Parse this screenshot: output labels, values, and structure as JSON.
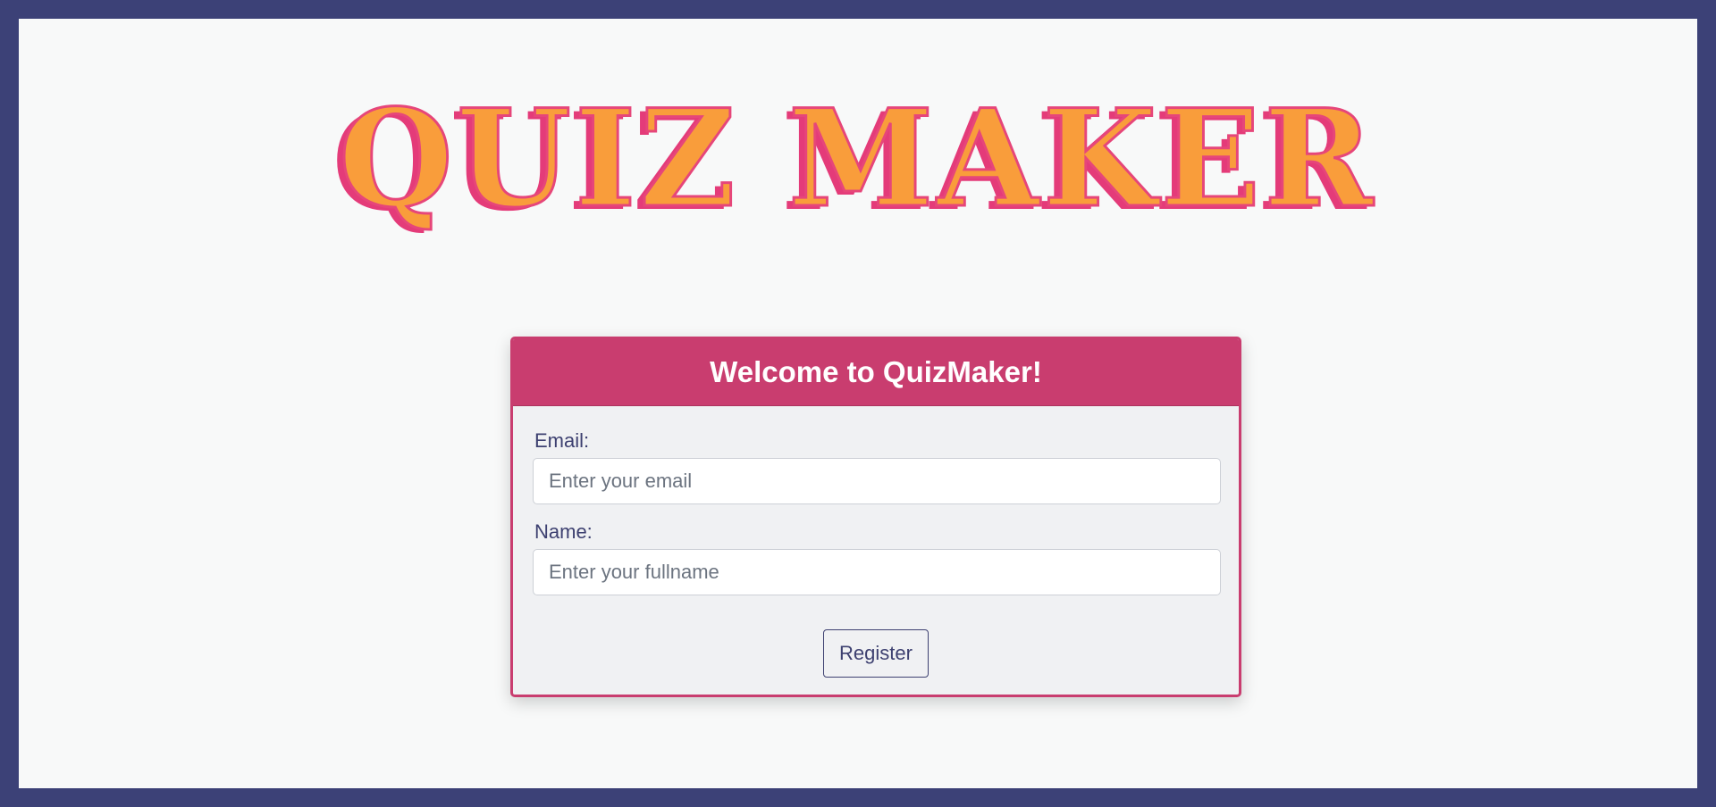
{
  "logo": {
    "text": "QUIZ MAKER"
  },
  "card": {
    "title": "Welcome to QuizMaker!",
    "email": {
      "label": "Email:",
      "placeholder": "Enter your email",
      "value": ""
    },
    "name": {
      "label": "Name:",
      "placeholder": "Enter your fullname",
      "value": ""
    },
    "register_label": "Register"
  },
  "colors": {
    "frame_border": "#3c4177",
    "page_background": "#f8f9f9",
    "accent": "#c93d6f",
    "logo_fill": "#f99d3b",
    "logo_shadow": "#e43b79",
    "text": "#3d4070"
  }
}
